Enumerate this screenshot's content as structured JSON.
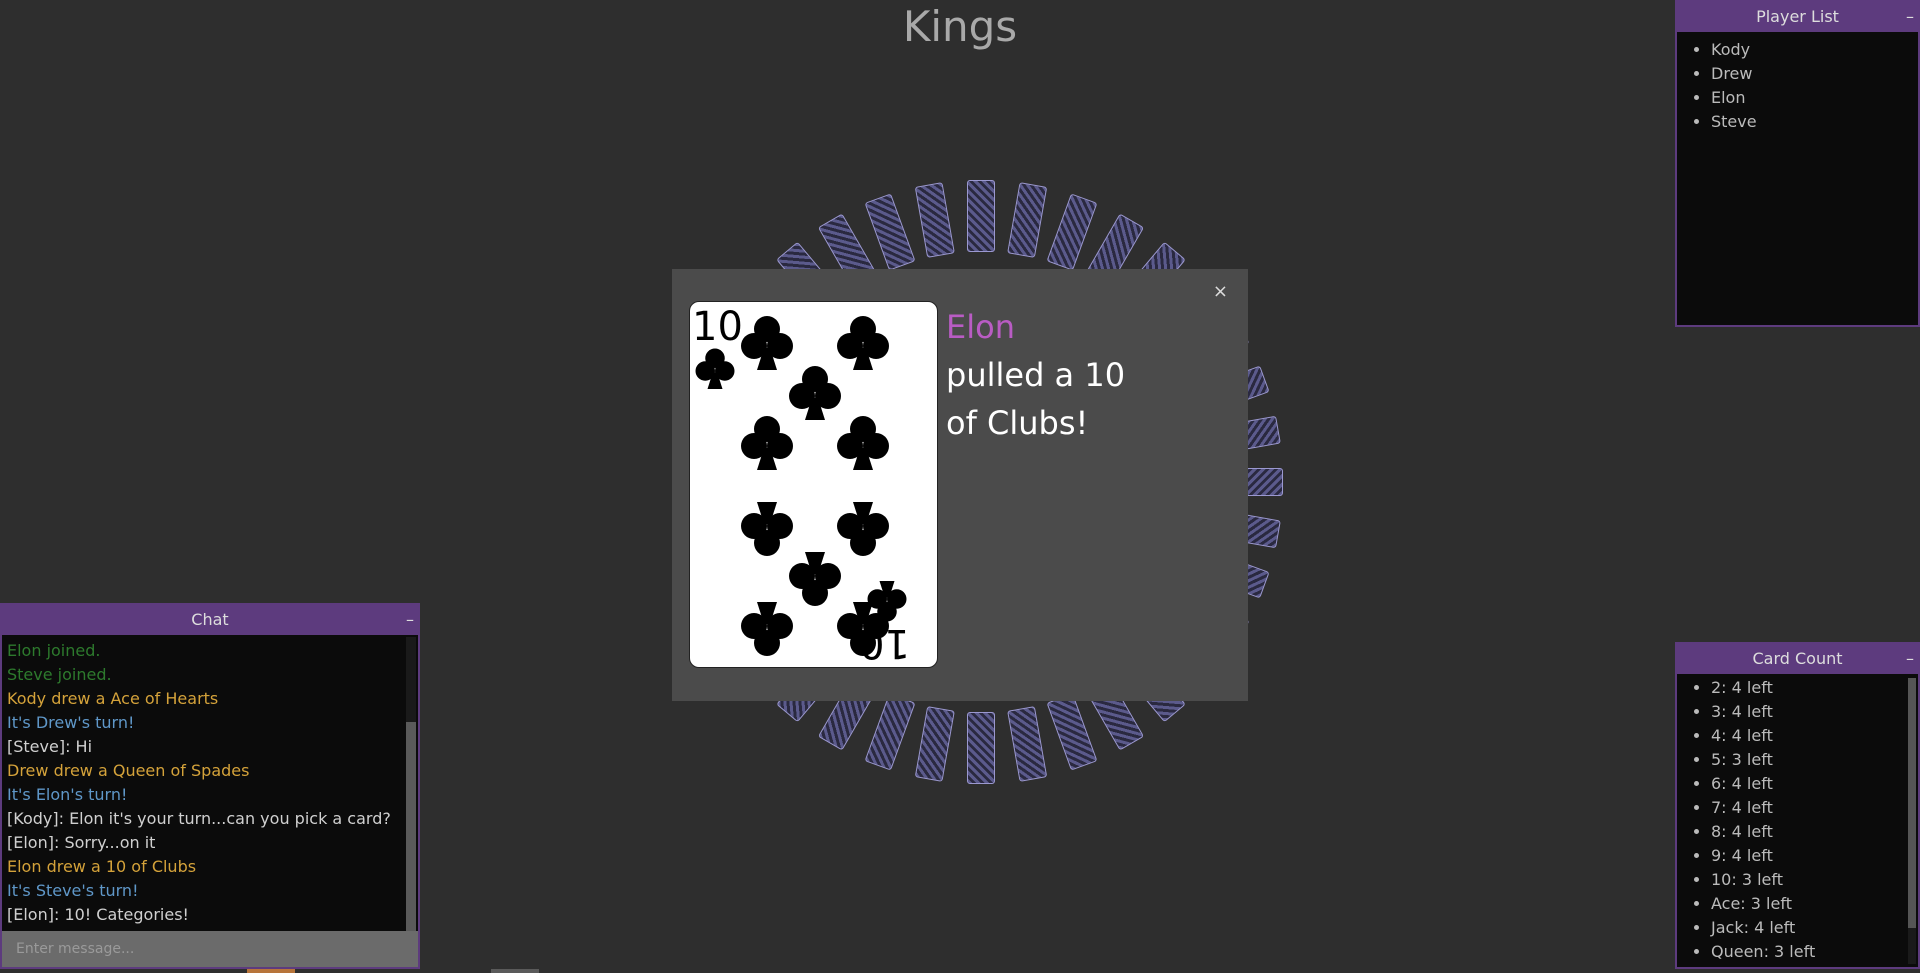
{
  "page": {
    "title": "Kings"
  },
  "player_list": {
    "header": "Player List",
    "minimize": "–",
    "players": [
      "Kody",
      "Drew",
      "Elon",
      "Steve"
    ]
  },
  "card_count": {
    "header": "Card Count",
    "minimize": "–",
    "items": [
      "2: 4 left",
      "3: 4 left",
      "4: 4 left",
      "5: 3 left",
      "6: 4 left",
      "7: 4 left",
      "8: 4 left",
      "9: 4 left",
      "10: 3 left",
      "Ace: 3 left",
      "Jack: 4 left",
      "Queen: 3 left"
    ]
  },
  "chat": {
    "header": "Chat",
    "minimize": "–",
    "messages": [
      {
        "text": "Elon joined.",
        "kind": "green"
      },
      {
        "text": "Steve joined.",
        "kind": "green"
      },
      {
        "text": "Kody drew a Ace of Hearts",
        "kind": "gold"
      },
      {
        "text": "It's Drew's turn!",
        "kind": "blue"
      },
      {
        "text": "[Steve]: Hi",
        "kind": "white"
      },
      {
        "text": "Drew drew a Queen of Spades",
        "kind": "gold"
      },
      {
        "text": "It's Elon's turn!",
        "kind": "blue"
      },
      {
        "text": "[Kody]: Elon it's your turn...can you pick a card?",
        "kind": "white"
      },
      {
        "text": "[Elon]: Sorry...on it",
        "kind": "white"
      },
      {
        "text": "Elon drew a 10 of Clubs",
        "kind": "gold"
      },
      {
        "text": "It's Steve's turn!",
        "kind": "blue"
      },
      {
        "text": "[Elon]: 10! Categories!",
        "kind": "white"
      }
    ],
    "input_placeholder": "Enter message..."
  },
  "modal": {
    "close": "×",
    "player": "Elon",
    "line1": "pulled a 10",
    "line2": "of Clubs!",
    "card": {
      "rank": "10",
      "suit": "clubs",
      "suit_symbol": "♣"
    }
  }
}
